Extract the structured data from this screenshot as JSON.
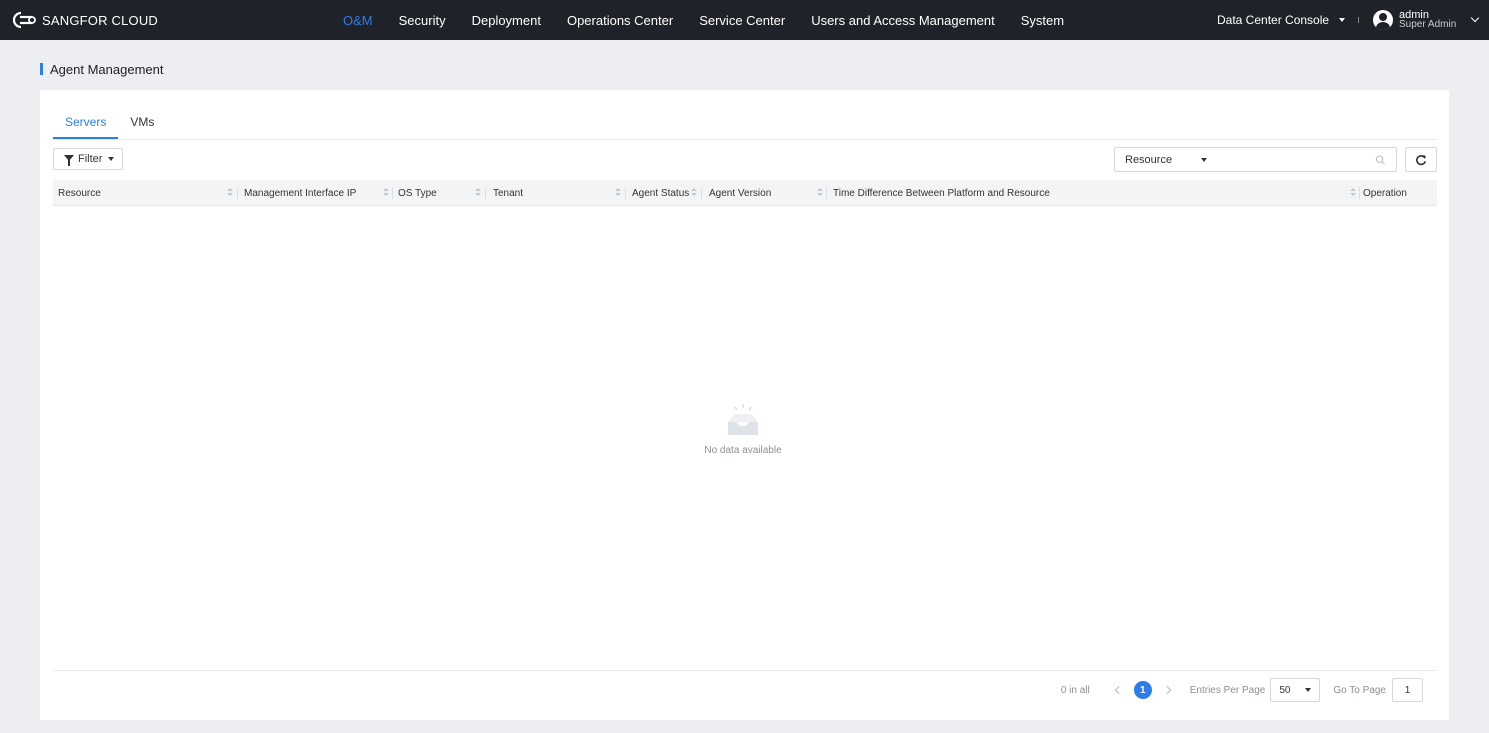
{
  "header": {
    "logo_text": "SANGFOR CLOUD",
    "nav": [
      {
        "label": "O&M",
        "active": true
      },
      {
        "label": "Security"
      },
      {
        "label": "Deployment"
      },
      {
        "label": "Operations Center"
      },
      {
        "label": "Service Center"
      },
      {
        "label": "Users and Access Management"
      },
      {
        "label": "System"
      }
    ],
    "console_label": "Data Center Console",
    "user_name": "admin",
    "user_role": "Super Admin"
  },
  "page": {
    "title": "Agent Management"
  },
  "tabs": [
    {
      "label": "Servers",
      "active": true
    },
    {
      "label": "VMs"
    }
  ],
  "toolbar": {
    "filter_label": "Filter",
    "search_scope": "Resource",
    "search_placeholder": ""
  },
  "table": {
    "columns": [
      "Resource",
      "Management Interface IP",
      "OS Type",
      "Tenant",
      "Agent Status",
      "Agent Version",
      "Time Difference Between Platform and Resource",
      "Operation"
    ],
    "rows": [],
    "empty_text": "No data available"
  },
  "pagination": {
    "total": "0 in all",
    "current_page": "1",
    "entries_label": "Entries Per Page",
    "entries_value": "50",
    "goto_label": "Go To Page",
    "goto_value": "1"
  },
  "colors": {
    "accent": "#2b7de9",
    "topbar": "#1f2329",
    "background": "#eceef2"
  }
}
